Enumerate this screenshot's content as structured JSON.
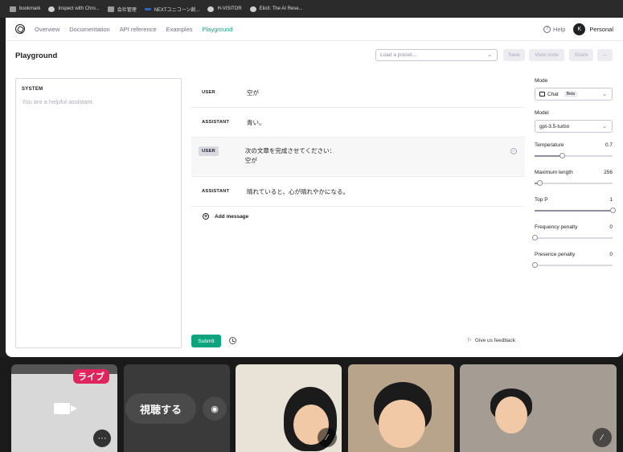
{
  "bookmarks": [
    "bookmark",
    "Inspect with Chro...",
    "会社管理",
    "NEXTユニコーン創...",
    "H-VISITOR",
    "Elicit: The AI Rese..."
  ],
  "nav": {
    "links": [
      "Overview",
      "Documentation",
      "API reference",
      "Examples",
      "Playground"
    ],
    "help": "Help",
    "avatar_initial": "K",
    "account": "Personal"
  },
  "page": {
    "title": "Playground",
    "preset_placeholder": "Load a preset...",
    "save": "Save",
    "view_code": "View code",
    "share": "Share",
    "more": "···"
  },
  "system": {
    "label": "SYSTEM",
    "placeholder": "You are a helpful assistant."
  },
  "messages": [
    {
      "role": "USER",
      "text": "空が"
    },
    {
      "role": "ASSISTANT",
      "text": "青い。"
    },
    {
      "role": "USER",
      "text": "次の文章を完成させてください：\n空が"
    },
    {
      "role": "ASSISTANT",
      "text": "晴れていると、心が晴れやかになる。"
    }
  ],
  "add_message": "Add message",
  "submit": "Submit",
  "feedback": "Give us feedback",
  "settings": {
    "mode_label": "Mode",
    "mode_value": "Chat",
    "beta": "Beta",
    "model_label": "Model",
    "model_value": "gpt-3.5-turbo",
    "sliders": [
      {
        "label": "Temperature",
        "value": "0.7",
        "fraction": 0.35
      },
      {
        "label": "Maximum length",
        "value": "256",
        "fraction": 0.06
      },
      {
        "label": "Top P",
        "value": "1",
        "fraction": 1.0
      },
      {
        "label": "Frequency penalty",
        "value": "0",
        "fraction": 0.0
      },
      {
        "label": "Presence penalty",
        "value": "0",
        "fraction": 0.0
      }
    ]
  },
  "meeting": {
    "live": "ライブ",
    "watch": "視聴する",
    "more": "···"
  }
}
